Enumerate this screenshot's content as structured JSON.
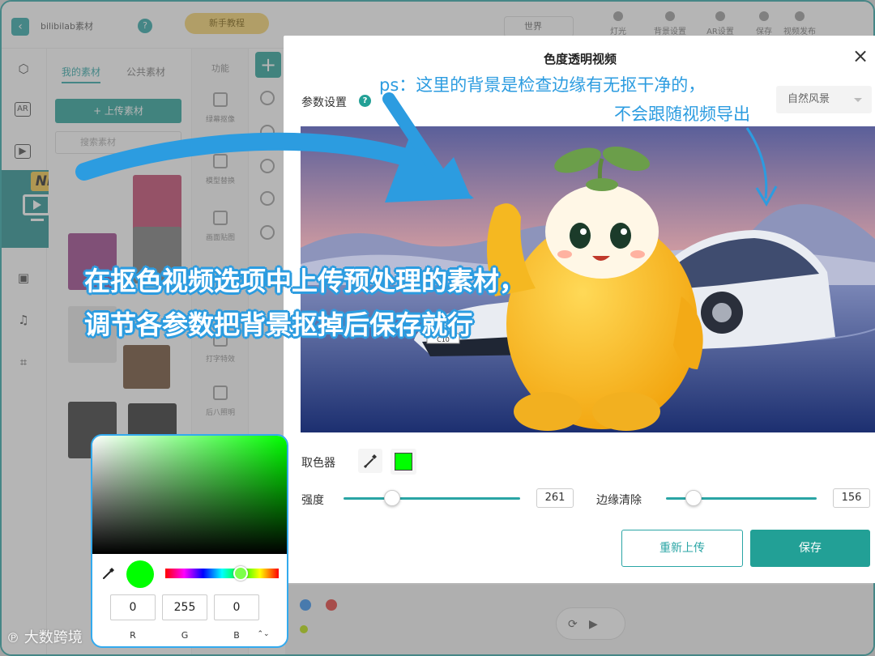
{
  "app": {
    "title": "bilibilab素材",
    "new_pill": "新手教程",
    "world_select": "世界",
    "toolbar": [
      "灯光",
      "背景设置",
      "AR设置",
      "保存",
      "视频发布"
    ]
  },
  "assets": {
    "tabs": [
      "我的素材",
      "公共素材"
    ],
    "upload_label": "+ 上传素材",
    "search_placeholder": "搜索素材"
  },
  "effects": {
    "header": "功能",
    "items": [
      "绿幕抠像",
      "模型替换",
      "画面贴图",
      "打字特效",
      "后八照明"
    ]
  },
  "rail": {
    "new_badge": "NEW"
  },
  "modal": {
    "title": "色度透明视频",
    "close": "×",
    "param_label": "参数设置",
    "param_help": "?",
    "scene_select": "自然风景",
    "picker_label": "取色器",
    "picker_color": "#00ff00",
    "strength_label": "强度",
    "strength_value": "261",
    "edge_label": "边缘清除",
    "edge_value": "156",
    "reupload_label": "重新上传",
    "save_label": "保存"
  },
  "color_picker": {
    "color": "#00ff00",
    "r": "0",
    "g": "255",
    "b": "0",
    "r_label": "R",
    "g_label": "G",
    "b_label": "B",
    "toggle": "⌃⌄"
  },
  "annotations": {
    "main_line1": "在抠色视频选项中上传预处理的素材，",
    "main_line2": "调节各参数把背景抠掉后保存就行",
    "ps_line1": "ps：这里的背景是检查边缘有无抠干净的，",
    "ps_line2": "不会跟随视频导出",
    "watermark": "大数跨境",
    "accent": "#2c9ce0"
  },
  "preview": {
    "car_plate": "C10"
  }
}
